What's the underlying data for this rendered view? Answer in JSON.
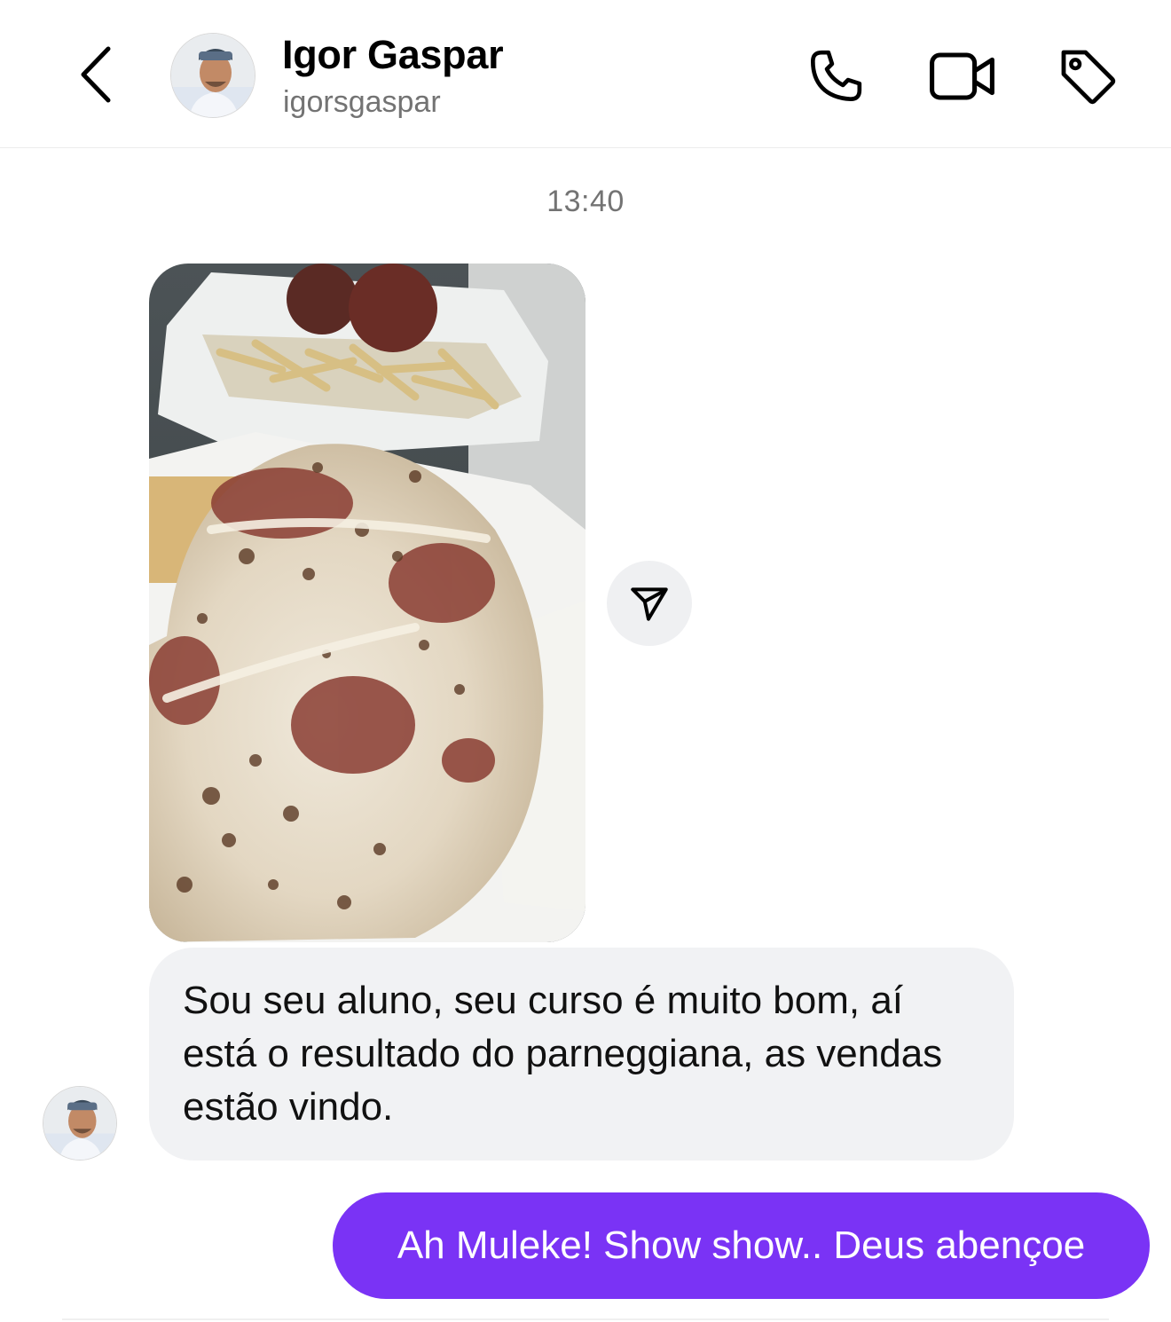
{
  "header": {
    "name": "Igor Gaspar",
    "username": "igorsgaspar",
    "icons": [
      "back-chevron-icon",
      "avatar",
      "phone-icon",
      "video-camera-icon",
      "tag-icon"
    ]
  },
  "thread": {
    "timestamp": "13:40",
    "messages": [
      {
        "type": "photo",
        "from": "contact",
        "icon": "share-send-icon"
      },
      {
        "type": "text",
        "from": "contact",
        "text": "Sou seu aluno, seu curso é muito bom, aí está o resultado do parneggiana, as vendas estão vindo."
      },
      {
        "type": "text",
        "from": "me",
        "text": "Ah Muleke! Show show.. Deus abençoe"
      }
    ]
  },
  "colors": {
    "sent_bubble": "#7a33f5",
    "received_bubble": "#f1f2f4",
    "secondary_text": "#737373"
  }
}
